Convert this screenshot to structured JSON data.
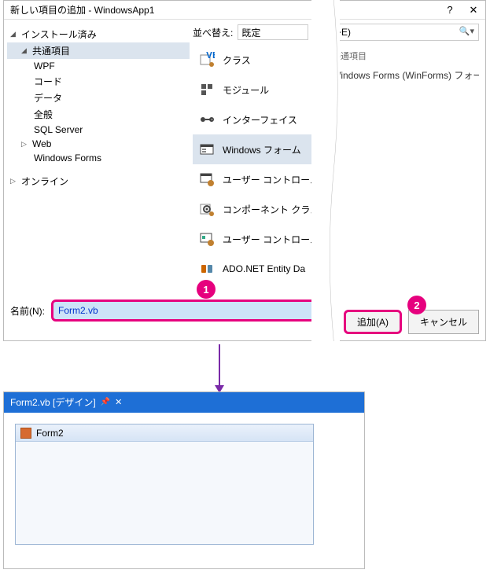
{
  "dialog": {
    "title": "新しい項目の追加 - WindowsApp1",
    "tree": {
      "installed": "インストール済み",
      "common": "共通項目",
      "items": [
        "WPF",
        "コード",
        "データ",
        "全般",
        "SQL Server",
        "Web",
        "Windows Forms"
      ],
      "online": "オンライン"
    },
    "sort": {
      "label": "並べ替え:",
      "value": "既定"
    },
    "templates": [
      {
        "label": "クラス",
        "icon": "vb-class"
      },
      {
        "label": "モジュール",
        "icon": "module"
      },
      {
        "label": "インターフェイス",
        "icon": "interface"
      },
      {
        "label": "Windows フォーム",
        "icon": "form",
        "selected": true
      },
      {
        "label": "ユーザー コントロール",
        "icon": "usercontrol"
      },
      {
        "label": "コンポーネント クラス",
        "icon": "component"
      },
      {
        "label": "ユーザー コントロール",
        "icon": "usercontrol2"
      },
      {
        "label": "ADO.NET Entity Da",
        "icon": "ado"
      }
    ],
    "search": {
      "suffix": "+E)"
    },
    "detail": {
      "category": "共通項目",
      "desc": "Windows Forms (WinForms) フォーム"
    },
    "name": {
      "label": "名前(N):",
      "value": "Form2.vb"
    },
    "buttons": {
      "add": "追加(A)",
      "cancel": "キャンセル"
    }
  },
  "markers": {
    "one": "1",
    "two": "2"
  },
  "designer": {
    "tab": "Form2.vb [デザイン]",
    "pin": "⊕",
    "close": "✕",
    "formTitle": "Form2"
  }
}
